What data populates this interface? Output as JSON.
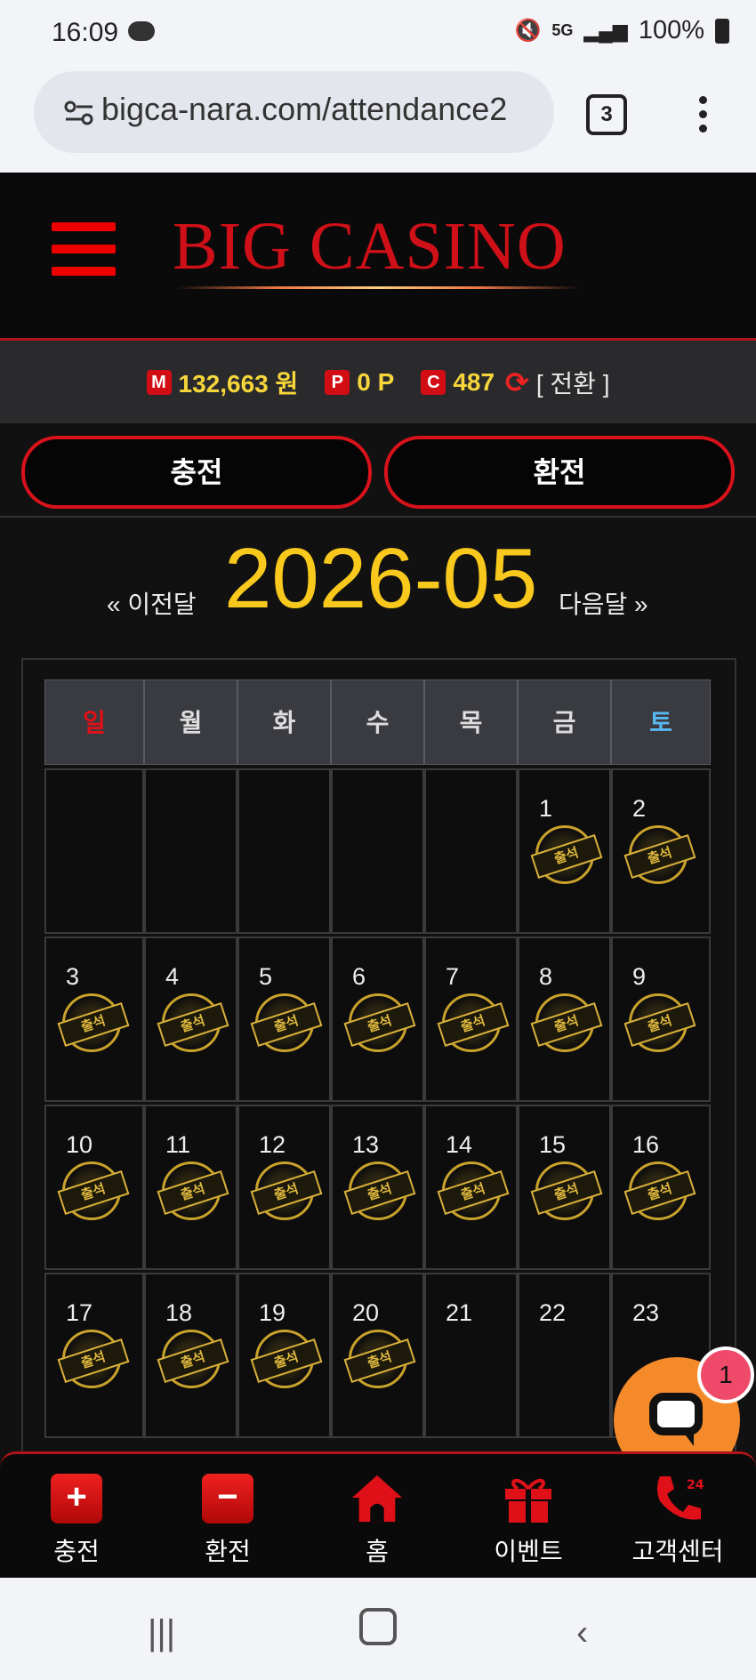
{
  "status_bar": {
    "time": "16:09",
    "battery": "100%",
    "network": "5G"
  },
  "browser": {
    "url": "bigca-nara.com/attendance2",
    "tab_count": "3"
  },
  "header": {
    "logo": "BIG CASINO"
  },
  "balances": {
    "money_badge": "M",
    "money": "132,663 원",
    "point_badge": "P",
    "point": "0 P",
    "coin_badge": "C",
    "coin": "487",
    "switch_label": "[ 전환 ]"
  },
  "actions": {
    "deposit": "충전",
    "withdraw": "환전"
  },
  "calendar": {
    "month": "2026-05",
    "prev": "« 이전달",
    "next": "다음달 »",
    "weekdays": [
      "일",
      "월",
      "화",
      "수",
      "목",
      "금",
      "토"
    ],
    "stamp_label": "출석",
    "weeks": [
      [
        "",
        "",
        "",
        "",
        "",
        "1",
        "2"
      ],
      [
        "3",
        "4",
        "5",
        "6",
        "7",
        "8",
        "9"
      ],
      [
        "10",
        "11",
        "12",
        "13",
        "14",
        "15",
        "16"
      ],
      [
        "17",
        "18",
        "19",
        "20",
        "21",
        "22",
        "23"
      ]
    ],
    "attended_days": [
      1,
      2,
      3,
      4,
      5,
      6,
      7,
      8,
      9,
      10,
      11,
      12,
      13,
      14,
      15,
      16,
      17,
      18,
      19,
      20
    ]
  },
  "bottom_nav": [
    {
      "label": "충전",
      "icon": "plus-icon"
    },
    {
      "label": "환전",
      "icon": "minus-icon"
    },
    {
      "label": "홈",
      "icon": "home-icon"
    },
    {
      "label": "이벤트",
      "icon": "gift-icon"
    },
    {
      "label": "고객센터",
      "icon": "phone-icon"
    }
  ],
  "chat": {
    "badge": "1"
  },
  "colors": {
    "accent_red": "#d20d14",
    "gold": "#f8c91c",
    "chat_orange": "#f58a2b"
  }
}
